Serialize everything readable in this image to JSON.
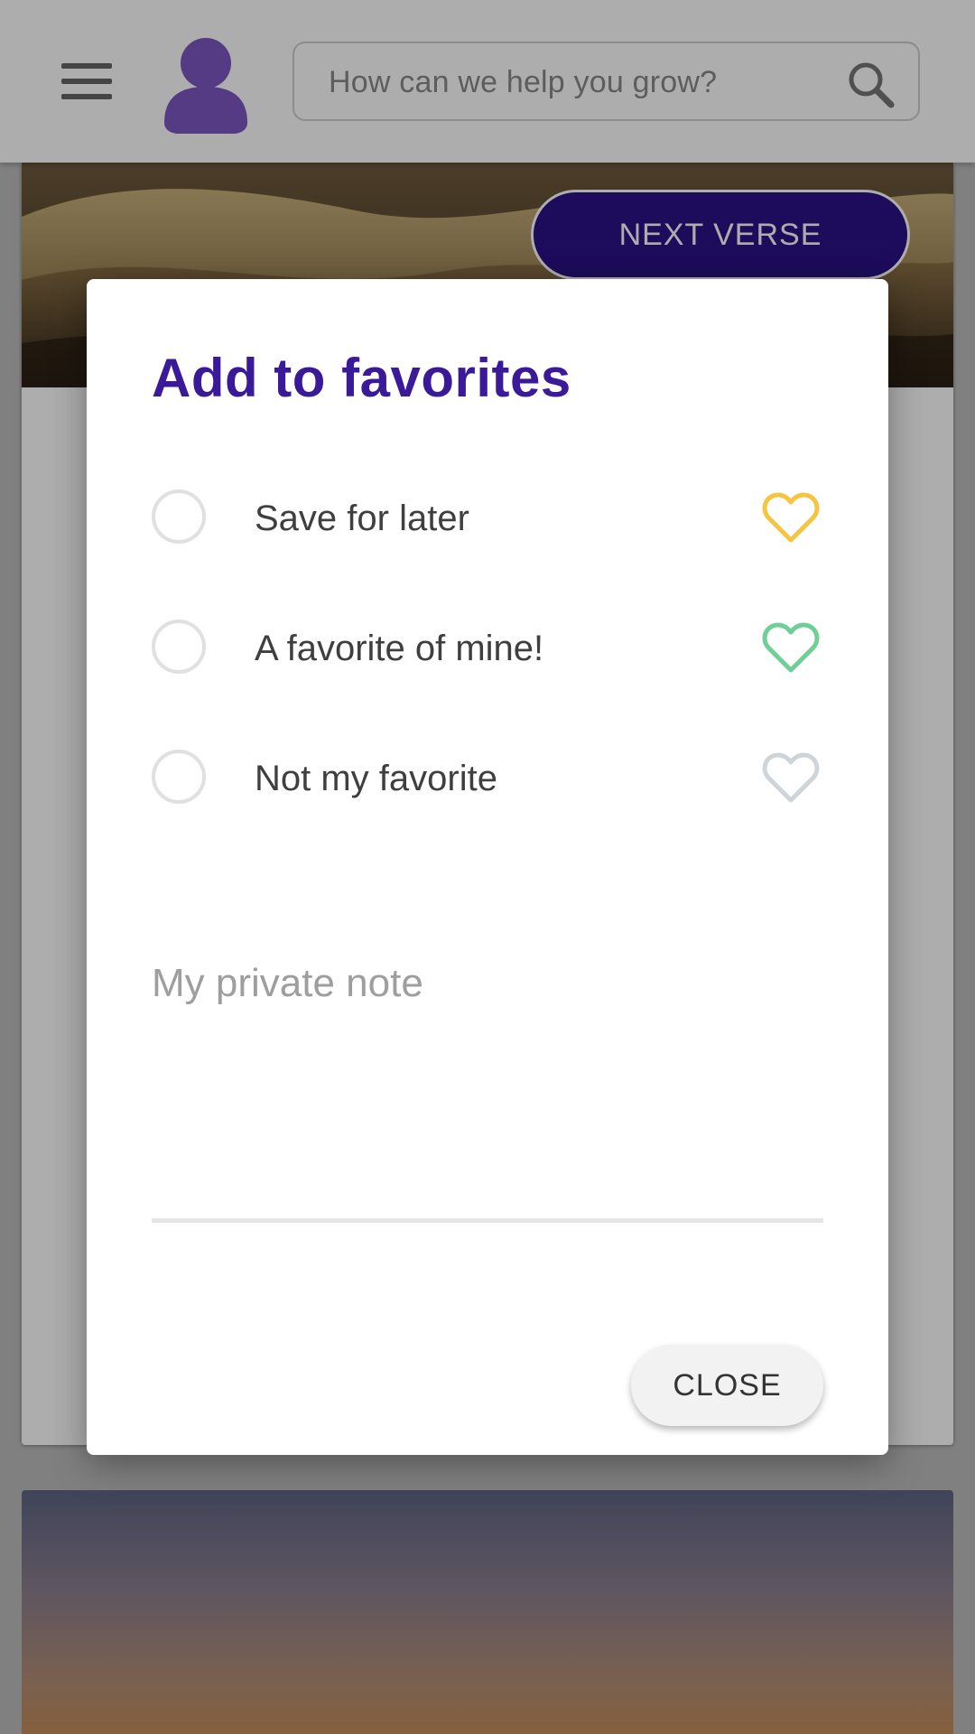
{
  "header": {
    "menu_icon": "hamburger-menu-icon",
    "avatar_icon": "user-avatar-icon",
    "search": {
      "placeholder": "How can we help you grow?",
      "icon": "search-icon"
    }
  },
  "card": {
    "next_button": "NEXT VERSE"
  },
  "dialog": {
    "title": "Add to favorites",
    "options": [
      {
        "label": "Save for later",
        "selected": false,
        "heart_color": "#f4c542"
      },
      {
        "label": "A favorite of mine!",
        "selected": false,
        "heart_color": "#6fcf97"
      },
      {
        "label": "Not my favorite",
        "selected": false,
        "heart_color": "#cfd4d8"
      }
    ],
    "note": {
      "placeholder": "My private note"
    },
    "close_label": "CLOSE"
  },
  "colors": {
    "brand_purple": "#3b1a9a",
    "button_purple": "#2b1187",
    "avatar_purple": "#7e57c2"
  }
}
